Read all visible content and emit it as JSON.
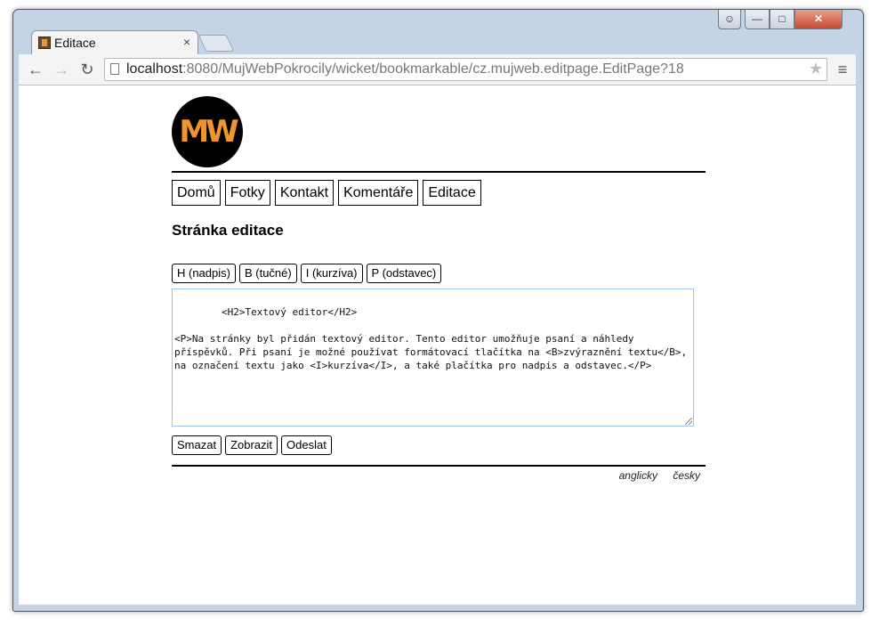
{
  "browser": {
    "tab_title": "Editace",
    "tab_close": "×",
    "url_host": "localhost",
    "url_rest": ":8080/MujWebPokrocily/wicket/bookmarkable/cz.mujweb.editpage.EditPage?18",
    "icons": {
      "back": "back-arrow-icon",
      "forward": "forward-arrow-icon",
      "reload": "reload-icon",
      "star": "star-icon",
      "menu": "hamburger-menu-icon"
    }
  },
  "site": {
    "logo_text": "MW",
    "logo_color": "#f0952a",
    "menu": [
      "Domů",
      "Fotky",
      "Kontakt",
      "Komentáře",
      "Editace"
    ],
    "page_heading": "Stránka editace",
    "format_buttons": [
      "H (nadpis)",
      "B (tučné)",
      "I (kurzíva)",
      "P (odstavec)"
    ],
    "editor_text": "<H2>Textový editor</H2>\n\n<P>Na stránky byl přidán textový editor. Tento editor umožňuje psaní a náhledy příspěvků. Při psaní je možné používat formátovací tlačítka na <B>zvýraznění textu</B>, na označení textu jako <I>kurzíva</I>, a také plačítka pro nadpis a odstavec.</P>",
    "action_buttons": [
      "Smazat",
      "Zobrazit",
      "Odeslat"
    ],
    "languages": [
      "anglicky",
      "česky"
    ]
  }
}
